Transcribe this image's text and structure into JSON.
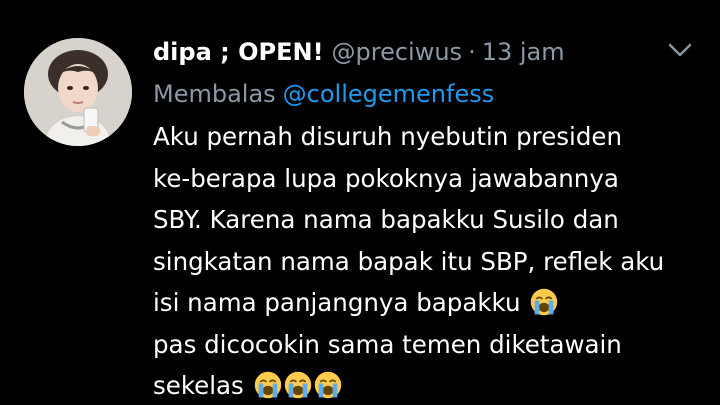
{
  "tweet": {
    "author": {
      "display_name": "dipa ; OPEN!",
      "handle": "@preciwus",
      "separator": "·",
      "time": "13 jam"
    },
    "reply": {
      "prefix": "Membalas",
      "mention": "@collegemenfess"
    },
    "body_lines": [
      "Aku pernah disuruh nyebutin presiden",
      "ke-berapa lupa pokoknya jawabannya",
      "SBY. Karena nama bapakku Susilo dan",
      "singkatan nama bapak itu SBP, reflek aku",
      "isi nama panjangnya bapakku",
      "pas dicocokin sama temen diketawain",
      "sekelas"
    ],
    "emoji": {
      "line5": "loudly-crying-face",
      "line7": [
        "loudly-crying-face",
        "loudly-crying-face",
        "loudly-crying-face"
      ]
    },
    "colors": {
      "background": "#000000",
      "text": "#ffffff",
      "secondary": "#8b98a5",
      "link": "#1d9bf0",
      "emoji": "#ffcc4d"
    }
  }
}
